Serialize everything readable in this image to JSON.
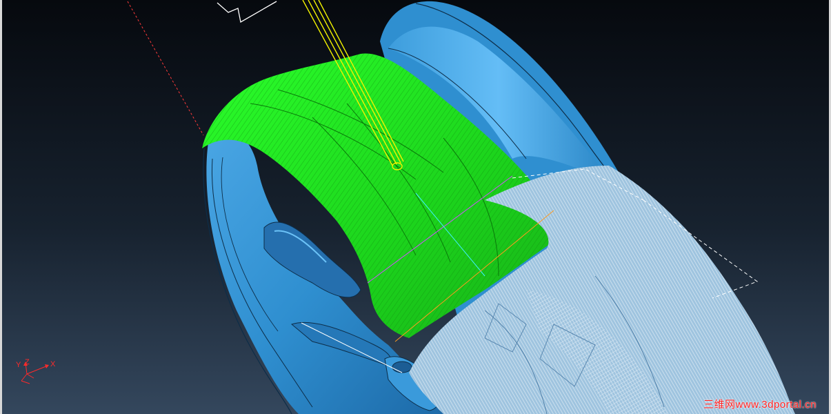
{
  "viewport": {
    "background_top": "#0a0e14",
    "background_bottom": "#34475d"
  },
  "model": {
    "part_color": "#2f8fd0",
    "part_highlight": "#5cb4f0",
    "part_shadow": "#1a5f97",
    "toolpath_finishing_color": "#22f022",
    "toolpath_roughing_color": "#d6e8f4",
    "tool_color": "#f2f200",
    "stock_outline_color": "#ffffff",
    "workplane_line_color": "#ff3a3a"
  },
  "axis_triad": {
    "labels": {
      "y": "Y",
      "z": "Z",
      "x": "X"
    },
    "color": "#ff2a2a"
  },
  "watermark": {
    "text": "三维网www.3dportal.cn",
    "color": "#ff2020"
  }
}
